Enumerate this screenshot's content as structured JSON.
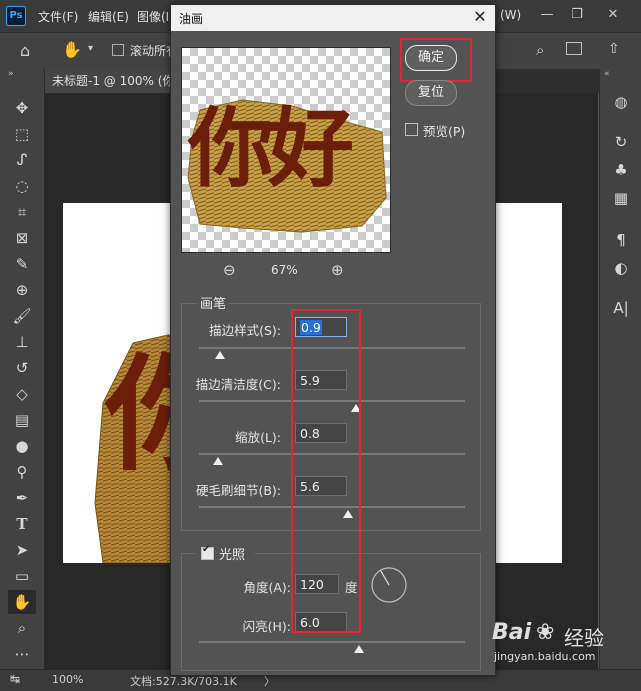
{
  "app": {
    "logo": "Ps",
    "menus": [
      "文件(F)",
      "编辑(E)",
      "图像(I"
    ],
    "menu_right": "(W)",
    "window_controls": [
      "—",
      "❐",
      "✕"
    ]
  },
  "options_bar": {
    "scroll_all_label": "滚动所有"
  },
  "document": {
    "tab_title": "未标题-1 @ 100% (你"
  },
  "status_bar": {
    "zoom": "100%",
    "doc_info": "文档:527.3K/703.1K",
    "arrow": "〉"
  },
  "dialog": {
    "title": "油画",
    "close": "✕",
    "ok_label": "确定",
    "reset_label": "复位",
    "preview_label": "预览(P)",
    "preview_checked": false,
    "preview_text": "你好",
    "zoom_value": "67%",
    "brush_group": {
      "label": "画笔",
      "params": [
        {
          "label": "描边样式(S):",
          "value": "0.9",
          "fraction": 0.08
        },
        {
          "label": "描边清洁度(C):",
          "value": "5.9",
          "fraction": 0.59
        },
        {
          "label": "缩放(L):",
          "value": "0.8",
          "fraction": 0.07
        },
        {
          "label": "硬毛刷细节(B):",
          "value": "5.6",
          "fraction": 0.56
        }
      ]
    },
    "light_group": {
      "label": "光照",
      "checked": true,
      "angle_label": "角度(A):",
      "angle_value": "120",
      "angle_unit": "度",
      "shine_label": "闪亮(H):",
      "shine_value": "6.0",
      "shine_fraction": 0.6
    }
  },
  "canvas_text": "你",
  "watermark": {
    "brand": "Bai",
    "brand_cn": "经验",
    "url": "jingyan.baidu.com"
  },
  "colors": {
    "highlight": "#e0282e",
    "selection": "#2a6fd6",
    "text_fill": "#6b1e0a",
    "gold": "#c49a3c"
  }
}
